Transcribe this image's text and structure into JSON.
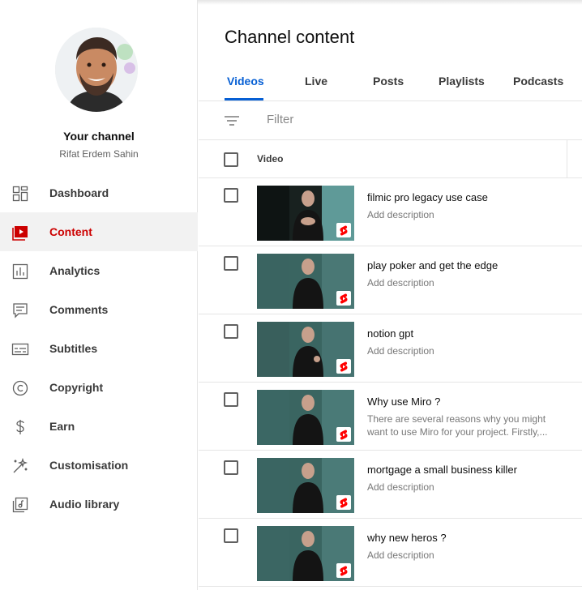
{
  "sidebar": {
    "channel_title": "Your channel",
    "channel_name": "Rifat Erdem Sahin",
    "items": [
      {
        "label": "Dashboard",
        "icon": "dashboard-icon"
      },
      {
        "label": "Content",
        "icon": "content-icon",
        "active": true
      },
      {
        "label": "Analytics",
        "icon": "analytics-icon"
      },
      {
        "label": "Comments",
        "icon": "comments-icon"
      },
      {
        "label": "Subtitles",
        "icon": "subtitles-icon"
      },
      {
        "label": "Copyright",
        "icon": "copyright-icon"
      },
      {
        "label": "Earn",
        "icon": "earn-icon"
      },
      {
        "label": "Customisation",
        "icon": "customisation-icon"
      },
      {
        "label": "Audio library",
        "icon": "audio-library-icon"
      }
    ]
  },
  "main": {
    "title": "Channel content",
    "tabs": [
      "Videos",
      "Live",
      "Posts",
      "Playlists",
      "Podcasts"
    ],
    "active_tab": "Videos",
    "filter_placeholder": "Filter",
    "column_video": "Video",
    "videos": [
      {
        "title": "filmic pro legacy use case",
        "description": "Add description"
      },
      {
        "title": "play poker and get the edge",
        "description": "Add description"
      },
      {
        "title": "notion gpt",
        "description": "Add description"
      },
      {
        "title": "Why use Miro ?",
        "description": "There are several reasons why you might want to use Miro for your project. Firstly,..."
      },
      {
        "title": "mortgage a small business killer",
        "description": "Add description"
      },
      {
        "title": "why new heros ?",
        "description": "Add description"
      }
    ]
  },
  "colors": {
    "accent_red": "#cc0000",
    "tab_blue": "#065fd4",
    "shorts_red": "#ff0000"
  }
}
